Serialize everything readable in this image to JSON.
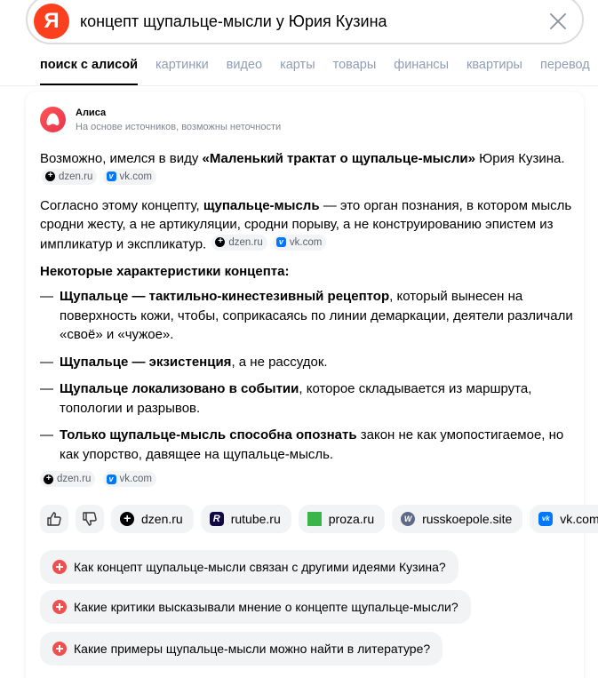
{
  "search": {
    "logo_letter": "Я",
    "query": "концепт щупальце-мысли у Юрия Кузина"
  },
  "tabs": [
    {
      "label": "поиск с алисой",
      "active": true
    },
    {
      "label": "картинки"
    },
    {
      "label": "видео"
    },
    {
      "label": "карты"
    },
    {
      "label": "товары"
    },
    {
      "label": "финансы"
    },
    {
      "label": "квартиры"
    },
    {
      "label": "перевод"
    }
  ],
  "alice": {
    "name": "Алиса",
    "subtitle": "На основе источников, возможны неточности"
  },
  "answer": {
    "p1": {
      "pre": "Возможно, имелся в виду ",
      "bold": "«Маленький трактат о щупальце-мысли»",
      "post": " Юрия Кузина."
    },
    "p2": {
      "pre": "Согласно этому концепту, ",
      "bold": "щупальце-мысль",
      "post": " — это орган познания, в котором мысль сродни жесту, а не артикуляции, сродни порыву, а не конструированию эпистем из импликатур и экспликатур."
    },
    "features_heading": "Некоторые характеристики концепта:",
    "items": [
      {
        "dash": "—",
        "bold": "Щупальце — тактильно-кинестезивный рецептор",
        "rest": ", который вынесен на поверхность кожи, чтобы, соприкасаясь по линии демаркации, деятели различали «своё» и «чужое»."
      },
      {
        "dash": "—",
        "bold": "Щупальце — экзистенция",
        "rest": ", а не рассудок."
      },
      {
        "dash": "—",
        "bold": "Щупальце локализовано в событии",
        "rest": ", которое складывается из маршрута, топологии и разрывов."
      },
      {
        "dash": "—",
        "bold": "Только щупальце-мысль способна опознать",
        "rest": " закон не как умопостигаемое, но как упорство, давящее на щупальце-мысль."
      }
    ],
    "sources": {
      "dzen": "dzen.ru",
      "vk": "vk.com"
    }
  },
  "source_chips": [
    {
      "label": "dzen.ru",
      "icon": "dzen-icon"
    },
    {
      "label": "rutube.ru",
      "icon": "rutube-icon"
    },
    {
      "label": "proza.ru",
      "icon": "proza-icon"
    },
    {
      "label": "russkoepole.site",
      "icon": "wordpress-icon"
    },
    {
      "label": "vk.com",
      "icon": "vk-icon"
    }
  ],
  "suggestions": [
    "Как концепт щупальце-мысли связан с другими идеями Кузина?",
    "Какие критики высказывали мнение о концепте щупальце-мысли?",
    "Какие примеры щупальце-мысли можно найти в литературе?"
  ],
  "colors": {
    "brand": "#fc3f1d",
    "accent_red": "#f14e4e",
    "chip_bg": "#f2f3f5",
    "tab_inactive": "#919cb5"
  }
}
